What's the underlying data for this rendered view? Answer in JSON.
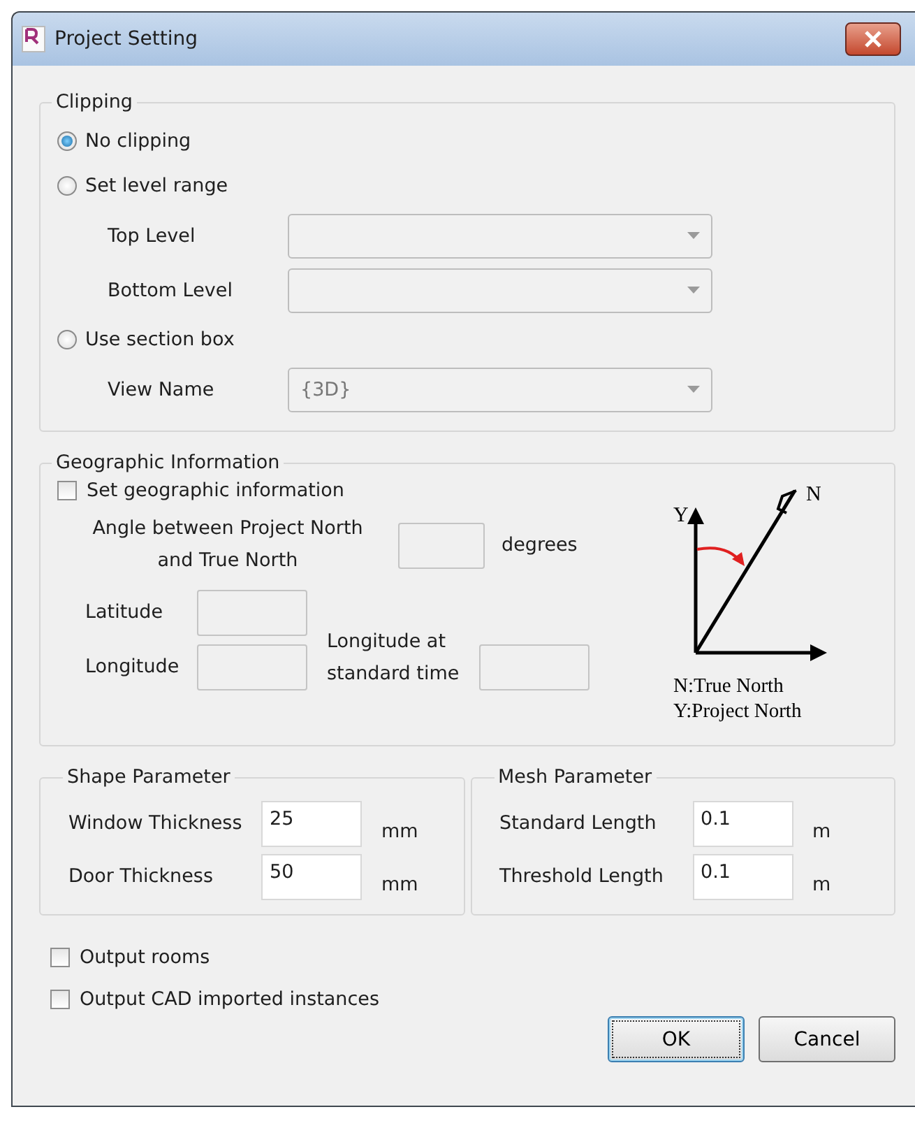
{
  "window": {
    "title": "Project Setting"
  },
  "clipping": {
    "title": "Clipping",
    "options": [
      {
        "label": "No clipping",
        "selected": true
      },
      {
        "label": "Set level range",
        "selected": false,
        "fields": [
          {
            "label": "Top Level",
            "disabled": true
          },
          {
            "label": "Bottom Level",
            "disabled": true
          }
        ]
      },
      {
        "label": "Use section box",
        "selected": false,
        "fields": [
          {
            "label": "View Name",
            "value": "{3D}",
            "disabled": true
          }
        ]
      }
    ]
  },
  "geographic": {
    "title": "Geographic Information",
    "checkbox": {
      "label": "Set geographic information",
      "checked": false
    },
    "angle": {
      "label": "Angle between Project North\nand True North",
      "unit": "degrees",
      "disabled": true
    },
    "latitude": {
      "label": "Latitude",
      "disabled": true
    },
    "longitude": {
      "label": "Longitude",
      "disabled": true
    },
    "standard": {
      "label": "Longitude at\nstandard time",
      "disabled": true
    },
    "diagram": {
      "y_label": "Y",
      "n_label": "N",
      "legend": [
        "N:True North",
        "Y:Project North"
      ]
    }
  },
  "shape": {
    "title": "Shape Parameter",
    "rows": [
      {
        "label": "Window Thickness",
        "value": "25",
        "unit": "mm"
      },
      {
        "label": "Door Thickness",
        "value": "50",
        "unit": "mm"
      }
    ]
  },
  "mesh": {
    "title": "Mesh Parameter",
    "rows": [
      {
        "label": "Standard Length",
        "value": "0.1",
        "unit": "m"
      },
      {
        "label": "Threshold Length",
        "value": "0.1",
        "unit": "m"
      }
    ]
  },
  "options": [
    {
      "label": "Output rooms",
      "checked": false
    },
    {
      "label": "Output CAD imported instances",
      "checked": false
    }
  ],
  "buttons": [
    {
      "label": "OK",
      "default": true
    },
    {
      "label": "Cancel",
      "default": false
    }
  ]
}
